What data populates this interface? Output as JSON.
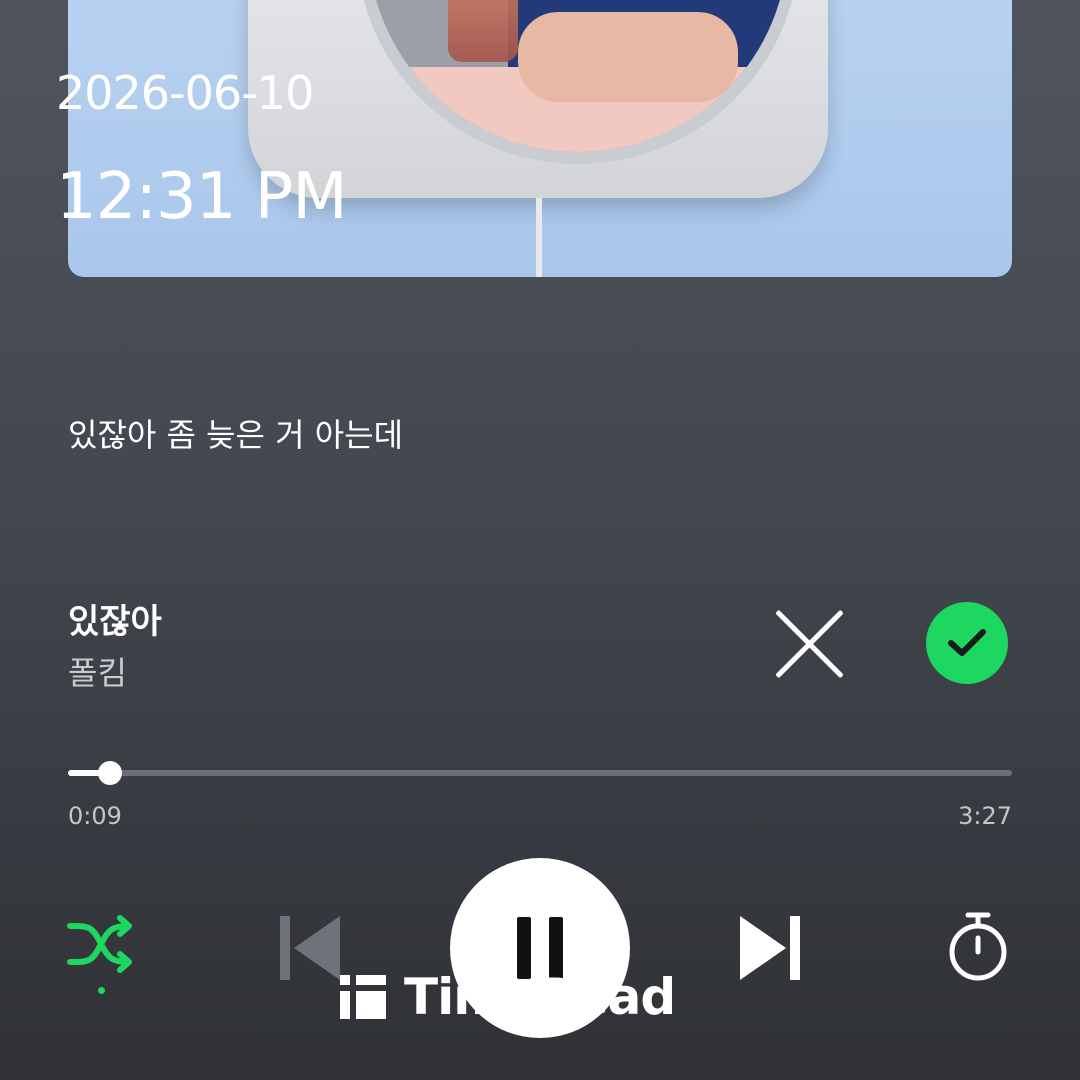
{
  "status": {
    "date": "2026-06-10",
    "time": "12:31 PM"
  },
  "lyrics": {
    "current_line": "있잖아 좀 늦은 거 아는데"
  },
  "track": {
    "title": "있잖아",
    "artist": "폴킴"
  },
  "progress": {
    "elapsed": "0:09",
    "total": "3:27",
    "fraction": 0.045
  },
  "controls": {
    "shuffle_icon": "shuffle-icon",
    "shuffle_active": true,
    "prev_icon": "skip-previous-icon",
    "play_state": "pause-icon",
    "next_icon": "skip-next-icon",
    "timer_icon": "sleep-timer-icon",
    "close_icon": "close-icon",
    "check_icon": "check-icon"
  },
  "watermark": {
    "text": "TimeRead"
  },
  "colors": {
    "accent": "#1ed760",
    "background_top": "#50555d",
    "background_bottom": "#2f3136"
  }
}
